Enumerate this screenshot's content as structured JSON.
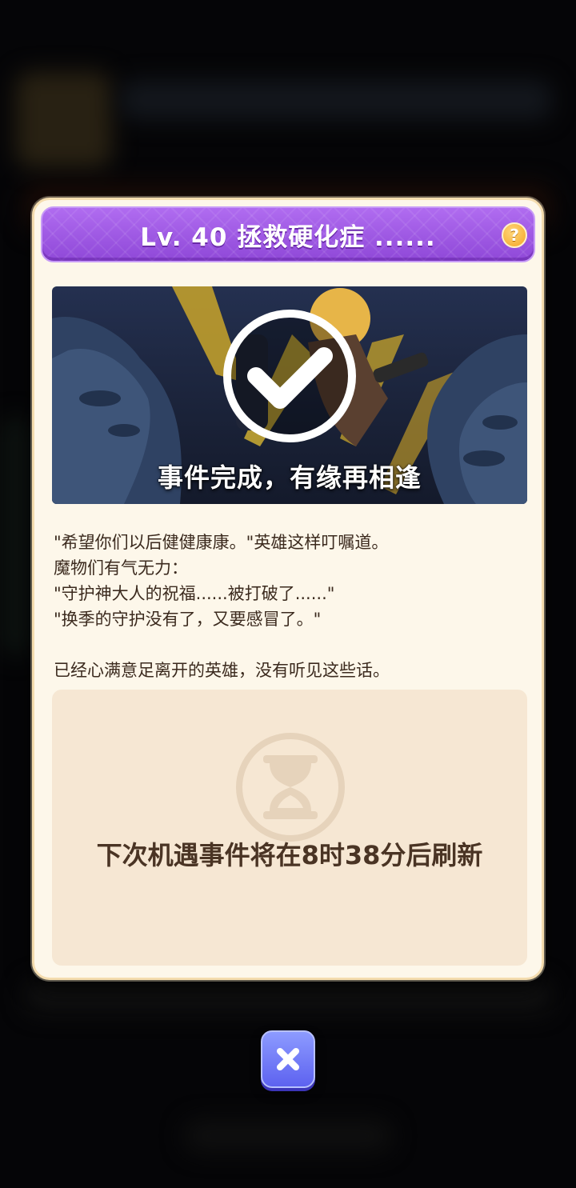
{
  "title": "Lv. 40 拯救硬化症 ......",
  "help_icon": "?",
  "banner": {
    "caption": "事件完成，有缘再相逢",
    "check_icon": "check-circle-icon"
  },
  "story_lines": [
    "\"希望你们以后健健康康。\"英雄这样叮嘱道。",
    "魔物们有气无力：",
    "\"守护神大人的祝福......被打破了......\"",
    "\"换季的守护没有了，又要感冒了。\"",
    "",
    "已经心满意足离开的英雄，没有听见这些话。"
  ],
  "timer": {
    "prefix": "下次机遇事件将在",
    "hours": "8",
    "hours_unit": "时",
    "minutes": "38",
    "minutes_unit": "分",
    "suffix": "后刷新",
    "icon": "hourglass-icon"
  },
  "close_icon": "close-icon",
  "colors": {
    "title_bar": "#9a55e0",
    "modal_bg": "#fdf7ea",
    "timer_panel": "#f6e7d3",
    "close_button": "#6f78f6",
    "help_button": "#f4a522"
  }
}
